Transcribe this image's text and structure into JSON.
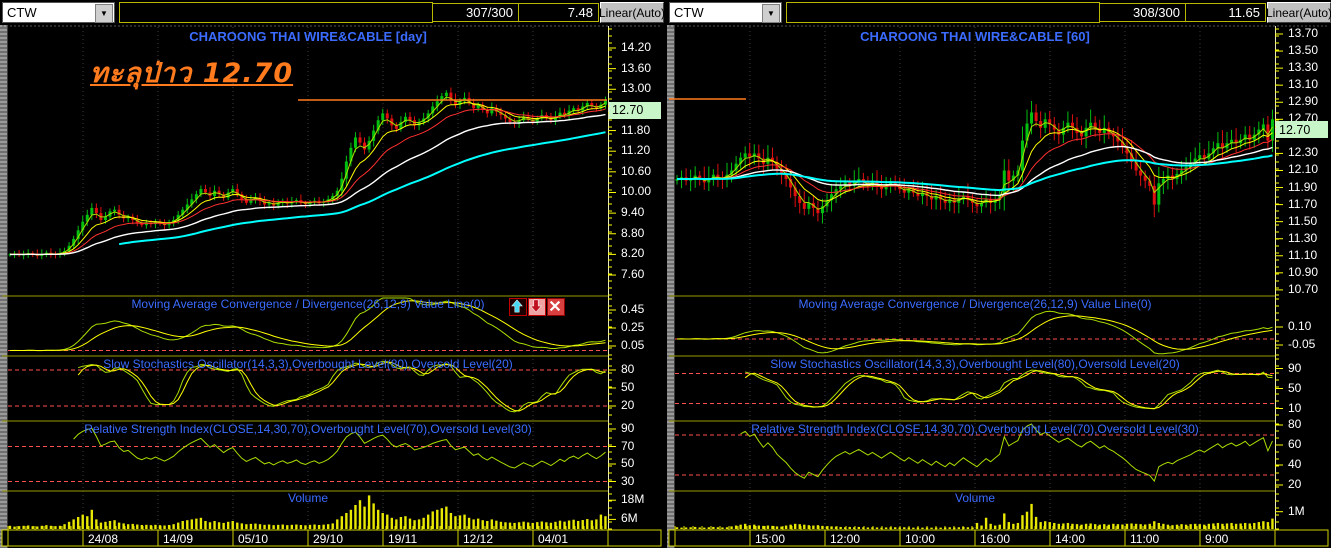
{
  "colors": {
    "title_blue": "#3b6cff",
    "annotation_orange": "#ff7b1e",
    "candle_up": "#00c010",
    "candle_down": "#e01010",
    "ma_fast": "#aadd00",
    "ma_mid": "#ffff00",
    "ma_slow": "#ff3030",
    "ma_long": "#ffffff",
    "ma_longest": "#00ffff",
    "volume_bar": "#e8e800",
    "axis_tick": "#ffff00",
    "last_price_bg": "#c9f6c9",
    "level_dashed": "#ff5050",
    "grid": "#3c3c3c",
    "separator": "#9a9a00"
  },
  "panels": [
    {
      "header": {
        "symbol": "CTW",
        "counter": "307/300",
        "last": "7.48",
        "scale": "Linear(Auto)"
      },
      "title": "CHAROONG THAI WIRE&CABLE [day]",
      "annotation": "ทะลุป่าว 12.70",
      "last_price": "12.70",
      "price_axis_labels": [
        "14.20",
        "13.60",
        "13.00",
        "11.80",
        "11.20",
        "10.60",
        "10.00",
        "9.40",
        "8.80",
        "8.20",
        "7.60"
      ],
      "macd": {
        "label": "Moving Average Convergence / Divergence(26,12,9) Value Line(0)",
        "ticks": [
          "0.45",
          "0.25",
          "0.05"
        ]
      },
      "stoch": {
        "label": "Slow Stochastics Oscillator(14,3,3),Overbought Level(80),Oversold Level(20)",
        "ticks": [
          "80",
          "50",
          "20"
        ]
      },
      "rsi": {
        "label": "Relative Strength Index(CLOSE,14,30,70),Overbought Level(70),Oversold Level(30)",
        "ticks": [
          "90",
          "70",
          "50",
          "30"
        ]
      },
      "volume": {
        "label": "Volume",
        "ticks": [
          "18M",
          "6M"
        ]
      },
      "x_labels": [
        "24/08",
        "14/09",
        "05/10",
        "29/10",
        "19/11",
        "12/12",
        "04/01"
      ],
      "toolbar": [
        {
          "name": "scroll-up-icon",
          "glyph": "up"
        },
        {
          "name": "scroll-down-icon",
          "glyph": "down"
        },
        {
          "name": "close-icon",
          "glyph": "x"
        }
      ]
    },
    {
      "header": {
        "symbol": "CTW",
        "counter": "308/300",
        "last": "11.65",
        "scale": "Linear(Auto)"
      },
      "title": "CHAROONG THAI WIRE&CABLE [60]",
      "annotation": null,
      "last_price": "12.70",
      "price_axis_labels": [
        "13.70",
        "13.50",
        "13.30",
        "13.10",
        "12.90",
        "12.70",
        "12.30",
        "12.10",
        "11.90",
        "11.70",
        "11.50",
        "11.30",
        "11.10",
        "10.90",
        "10.70"
      ],
      "macd": {
        "label": "Moving Average Convergence / Divergence(26,12,9) Value Line(0)",
        "ticks": [
          "0.10",
          "-0.05"
        ]
      },
      "stoch": {
        "label": "Slow Stochastics Oscillator(14,3,3),Overbought Level(80),Oversold Level(20)",
        "ticks": [
          "90",
          "50",
          "10"
        ]
      },
      "rsi": {
        "label": "Relative Strength Index(CLOSE,14,30,70),Overbought Level(70),Oversold Level(30)",
        "ticks": [
          "80",
          "60",
          "40",
          "20"
        ]
      },
      "volume": {
        "label": "Volume",
        "ticks": [
          "1M"
        ]
      },
      "x_labels": [
        "15:00",
        "12:00",
        "10:00",
        "16:00",
        "14:00",
        "11:00",
        "9:00"
      ],
      "toolbar": []
    }
  ],
  "chart_data": [
    {
      "type": "candlestick",
      "symbol": "CTW",
      "timeframe": "day",
      "title": "CHAROONG THAI WIRE&CABLE [day]",
      "price_axis_range": [
        7.6,
        14.2
      ],
      "trendline_price": 12.7,
      "annotation_text": "ทะลุป่าว 12.70",
      "last_price": 12.7,
      "overlays": [
        "ema-fast",
        "ema-mid",
        "ema-slow",
        "ema-long-white",
        "ema-longest-cyan"
      ],
      "indicators": [
        "MACD(26,12,9)",
        "SlowStochastics(14,3,3) 80/20",
        "RSI(CLOSE,14,30,70)",
        "Volume"
      ],
      "closes": [
        8.2,
        8.22,
        8.18,
        8.2,
        8.24,
        8.2,
        8.16,
        8.2,
        8.25,
        8.22,
        8.2,
        8.24,
        8.3,
        8.45,
        8.65,
        8.9,
        9.15,
        9.35,
        9.55,
        9.4,
        9.2,
        9.3,
        9.45,
        9.5,
        9.35,
        9.25,
        9.3,
        9.2,
        9.1,
        9.05,
        9.12,
        9.08,
        9.15,
        9.1,
        9.05,
        9.12,
        9.2,
        9.35,
        9.5,
        9.65,
        9.8,
        9.95,
        10.1,
        10.0,
        9.9,
        10.05,
        9.95,
        9.85,
        10.0,
        10.1,
        9.95,
        9.8,
        9.7,
        9.78,
        9.85,
        9.75,
        9.65,
        9.7,
        9.62,
        9.7,
        9.75,
        9.68,
        9.72,
        9.78,
        9.7,
        9.66,
        9.72,
        9.76,
        9.7,
        9.74,
        9.8,
        9.9,
        10.05,
        10.4,
        10.9,
        11.3,
        11.6,
        11.45,
        11.25,
        11.5,
        11.8,
        12.1,
        12.3,
        12.15,
        11.95,
        11.85,
        12.05,
        12.2,
        12.1,
        11.95,
        12.05,
        12.15,
        12.3,
        12.5,
        12.65,
        12.8,
        12.9,
        12.7,
        12.55,
        12.65,
        12.75,
        12.6,
        12.45,
        12.55,
        12.4,
        12.3,
        12.45,
        12.35,
        12.25,
        12.15,
        12.05,
        12.0,
        12.1,
        12.2,
        12.12,
        12.06,
        12.15,
        12.25,
        12.18,
        12.1,
        12.2,
        12.32,
        12.25,
        12.38,
        12.45,
        12.38,
        12.5,
        12.6,
        12.52,
        12.45,
        12.55,
        12.7
      ],
      "volumes_m": [
        2,
        1.5,
        1.8,
        2,
        2.2,
        1.8,
        1.6,
        2,
        2.4,
        2,
        1.8,
        2,
        3,
        4.5,
        6,
        7.5,
        9,
        8,
        12,
        6,
        4,
        4.5,
        5,
        5.5,
        4,
        3.5,
        3,
        3.2,
        2.8,
        2.5,
        2.6,
        2.4,
        2.6,
        2.4,
        2.2,
        2.5,
        3,
        4,
        5,
        5.5,
        6,
        6.5,
        7,
        5,
        4.2,
        5,
        4.2,
        3.8,
        4.5,
        5,
        4,
        3.5,
        3,
        3.2,
        3.4,
        3,
        2.6,
        2.8,
        2.4,
        2.6,
        2.8,
        2.4,
        2.6,
        2.8,
        2.5,
        2.3,
        2.6,
        2.8,
        2.5,
        2.7,
        3,
        3.5,
        6,
        8,
        10,
        12,
        15,
        18,
        14,
        21,
        16,
        12,
        10,
        9,
        7,
        6,
        7.5,
        8,
        6.5,
        5.5,
        6,
        7,
        9,
        11,
        12,
        13,
        14,
        10,
        8,
        8.5,
        9,
        7,
        6,
        6.5,
        5.5,
        5,
        6,
        5.2,
        4.5,
        4.2,
        4,
        3.8,
        4.2,
        4.6,
        4.1,
        3.8,
        4.3,
        4.7,
        4.2,
        3.9,
        4.5,
        5.2,
        4.6,
        5.3,
        5.8,
        5,
        5.6,
        6.2,
        5.4,
        6,
        9,
        8
      ]
    },
    {
      "type": "candlestick",
      "symbol": "CTW",
      "timeframe": "60min",
      "title": "CHAROONG THAI WIRE&CABLE [60]",
      "price_axis_range": [
        10.7,
        13.7
      ],
      "trendline_price": 12.7,
      "annotation_text": null,
      "last_price": 12.7,
      "overlays": [
        "ema-fast",
        "ema-mid",
        "ema-slow",
        "ema-long-white",
        "ema-longest-cyan"
      ],
      "indicators": [
        "MACD(26,12,9)",
        "SlowStochastics(14,3,3) 80/20",
        "RSI(CLOSE,14,30,70)",
        "Volume"
      ],
      "closes": [
        12.0,
        12.02,
        11.98,
        12.0,
        12.04,
        12.0,
        11.96,
        12.0,
        12.05,
        12.02,
        12.0,
        12.05,
        12.1,
        12.18,
        12.25,
        12.3,
        12.26,
        12.3,
        12.24,
        12.18,
        12.25,
        12.2,
        12.12,
        12.06,
        12.0,
        11.9,
        11.8,
        11.72,
        11.65,
        11.72,
        11.66,
        11.6,
        11.68,
        11.75,
        11.82,
        11.88,
        11.92,
        11.96,
        11.92,
        11.96,
        12.0,
        11.96,
        11.92,
        11.96,
        11.92,
        11.88,
        11.92,
        11.96,
        11.92,
        11.88,
        11.84,
        11.88,
        11.84,
        11.8,
        11.84,
        11.8,
        11.76,
        11.8,
        11.76,
        11.72,
        11.76,
        11.72,
        11.76,
        11.8,
        11.76,
        11.72,
        11.68,
        11.72,
        11.76,
        11.72,
        11.76,
        11.8,
        12.1,
        11.98,
        12.04,
        12.1,
        12.45,
        12.65,
        12.78,
        12.68,
        12.6,
        12.7,
        12.64,
        12.58,
        12.52,
        12.6,
        12.66,
        12.6,
        12.54,
        12.5,
        12.6,
        12.66,
        12.6,
        12.54,
        12.6,
        12.54,
        12.5,
        12.44,
        12.38,
        12.3,
        12.2,
        12.1,
        12.04,
        11.98,
        11.92,
        11.7,
        11.95,
        12.0,
        12.04,
        12.0,
        12.06,
        12.1,
        12.14,
        12.18,
        12.24,
        12.28,
        12.24,
        12.3,
        12.36,
        12.42,
        12.36,
        12.42,
        12.46,
        12.42,
        12.46,
        12.52,
        12.46,
        12.52,
        12.58,
        12.64,
        12.45,
        12.7
      ],
      "volumes_m": [
        0.1,
        0.08,
        0.09,
        0.1,
        0.12,
        0.09,
        0.08,
        0.1,
        0.12,
        0.1,
        0.09,
        0.1,
        0.15,
        0.2,
        0.25,
        0.3,
        0.22,
        0.25,
        0.2,
        0.18,
        0.2,
        0.18,
        0.15,
        0.14,
        0.2,
        0.25,
        0.3,
        0.28,
        0.25,
        0.22,
        0.2,
        0.22,
        0.18,
        0.16,
        0.15,
        0.14,
        0.12,
        0.1,
        0.12,
        0.1,
        0.12,
        0.1,
        0.09,
        0.1,
        0.09,
        0.08,
        0.09,
        0.1,
        0.1,
        0.09,
        0.1,
        0.09,
        0.08,
        0.09,
        0.08,
        0.09,
        0.08,
        0.09,
        0.08,
        0.09,
        0.1,
        0.09,
        0.1,
        0.12,
        0.1,
        0.09,
        0.35,
        0.2,
        0.65,
        0.3,
        0.2,
        0.25,
        0.9,
        0.4,
        0.3,
        0.35,
        0.8,
        1.0,
        1.45,
        0.7,
        0.4,
        0.45,
        0.4,
        0.35,
        0.3,
        0.32,
        0.35,
        0.3,
        0.28,
        0.25,
        0.3,
        0.32,
        0.28,
        0.25,
        0.28,
        0.25,
        0.3,
        0.28,
        0.26,
        0.3,
        0.32,
        0.3,
        0.28,
        0.26,
        0.3,
        0.45,
        0.35,
        0.3,
        0.25,
        0.22,
        0.25,
        0.28,
        0.25,
        0.28,
        0.3,
        0.28,
        0.25,
        0.3,
        0.32,
        0.35,
        0.3,
        0.32,
        0.35,
        0.3,
        0.32,
        0.35,
        0.32,
        0.35,
        0.4,
        0.45,
        0.4,
        0.6
      ]
    }
  ]
}
